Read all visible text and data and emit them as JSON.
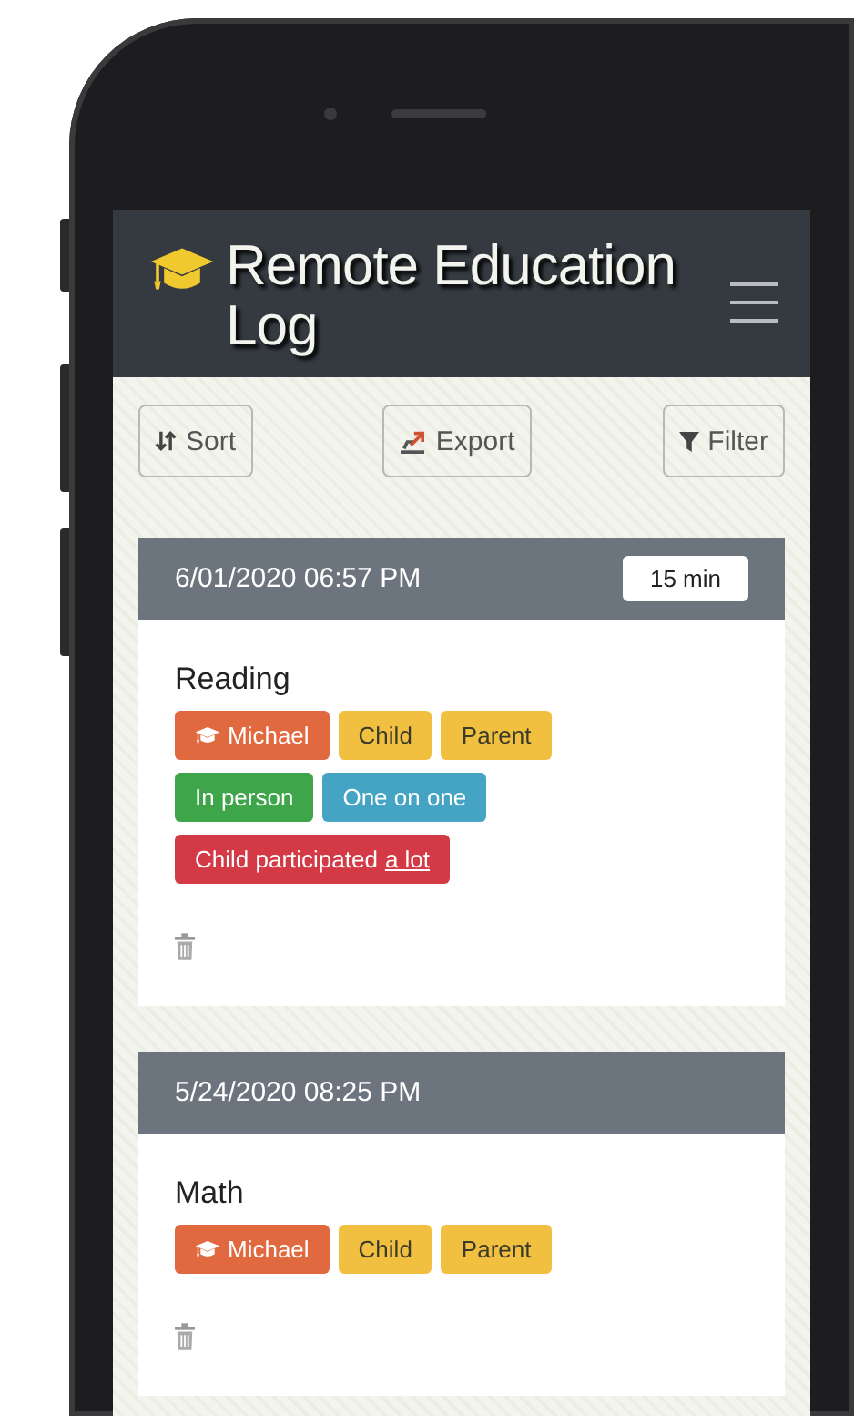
{
  "app": {
    "title": "Remote Education Log"
  },
  "toolbar": [
    {
      "kind": "sort",
      "label": "Sort"
    },
    {
      "kind": "export",
      "label": "Export"
    },
    {
      "kind": "filter",
      "label": "Filter"
    }
  ],
  "entries": [
    {
      "datetime": "6/01/2020 06:57 PM",
      "duration": "15 min",
      "subject": "Reading",
      "tags": [
        {
          "kind": "student",
          "label": "Michael",
          "color": "#e0693f"
        },
        {
          "kind": "plain",
          "label": "Child",
          "color": "#f2c041"
        },
        {
          "kind": "plain",
          "label": "Parent",
          "color": "#f2c041"
        },
        {
          "kind": "plain",
          "label": "In person",
          "color": "#3fa54a"
        },
        {
          "kind": "plain",
          "label": "One on one",
          "color": "#45a3c4"
        },
        {
          "kind": "plain",
          "label": "Child participated",
          "emphasis": "a lot",
          "color": "#d33a45"
        }
      ]
    },
    {
      "datetime": "5/24/2020 08:25 PM",
      "subject": "Math",
      "tags": [
        {
          "kind": "student",
          "label": "Michael",
          "color": "#e0693f"
        },
        {
          "kind": "plain",
          "label": "Child",
          "color": "#f2c041"
        },
        {
          "kind": "plain",
          "label": "Parent",
          "color": "#f2c041"
        }
      ]
    }
  ]
}
